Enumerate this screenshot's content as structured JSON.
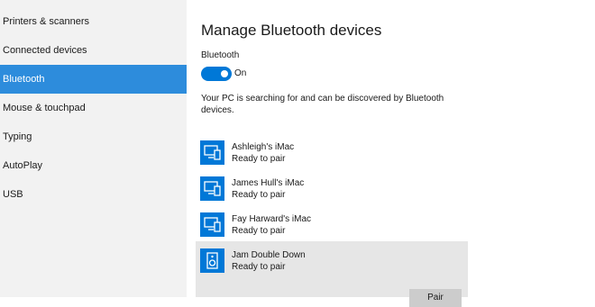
{
  "sidebar": {
    "items": [
      {
        "label": "Printers & scanners",
        "selected": false
      },
      {
        "label": "Connected devices",
        "selected": false
      },
      {
        "label": "Bluetooth",
        "selected": true
      },
      {
        "label": "Mouse & touchpad",
        "selected": false
      },
      {
        "label": "Typing",
        "selected": false
      },
      {
        "label": "AutoPlay",
        "selected": false
      },
      {
        "label": "USB",
        "selected": false
      }
    ]
  },
  "main": {
    "title": "Manage Bluetooth devices",
    "bluetooth_label": "Bluetooth",
    "toggle": {
      "state_label": "On",
      "on": true
    },
    "status_text": "Your PC is searching for and can be discovered by Bluetooth devices.",
    "devices": [
      {
        "name": "Ashleigh's iMac",
        "status": "Ready to pair",
        "icon": "computer-phone-icon"
      },
      {
        "name": "James Hull's iMac",
        "status": "Ready to pair",
        "icon": "computer-phone-icon"
      },
      {
        "name": "Fay Harward's iMac",
        "status": "Ready to pair",
        "icon": "computer-phone-icon"
      },
      {
        "name": "Jam Double Down",
        "status": "Ready to pair",
        "icon": "speaker-icon",
        "highlighted": true
      }
    ],
    "pair_button": {
      "label": "Pair"
    }
  },
  "colors": {
    "accent": "#0078d7",
    "selection": "#2d8cdc",
    "sidebar_bg": "#f2f2f2",
    "hover_bg": "#e6e6e6"
  }
}
